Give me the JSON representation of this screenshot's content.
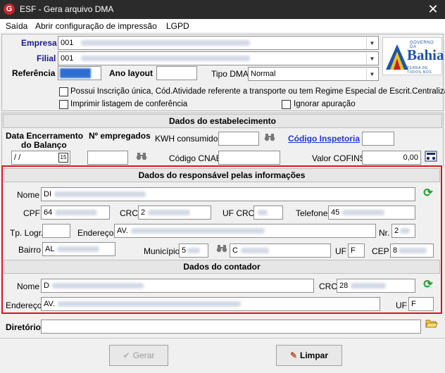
{
  "window": {
    "title": "ESF - Gera arquivo DMA",
    "app_icon_letter": "G"
  },
  "menu": [
    "Saída",
    "Abrir configuração de impressão",
    "LGPD"
  ],
  "header": {
    "empresa_label": "Empresa",
    "empresa_value": "001",
    "filial_label": "Filial",
    "filial_value": "001",
    "referencia_label": "Referência",
    "ano_layout_label": "Ano layout",
    "ano_layout_value": "",
    "tipo_dma_label": "Tipo DMA",
    "tipo_dma_value": "Normal",
    "logo_small": "GOVERNO DA",
    "logo_big": "Bahia",
    "logo_sub": "TERRA DE TODOS NÓS"
  },
  "options": {
    "inscricao_unica": "Possui Inscrição única, Cód.Atividade referente a transporte ou tem Regime Especial de Escrit.Centralizada",
    "imprimir_listagem": "Imprimir listagem de conferência",
    "ignorar_apuracao": "Ignorar apuração"
  },
  "estabelecimento": {
    "title": "Dados do estabelecimento",
    "data_enc_label_1": "Data Encerramento",
    "data_enc_label_2": "do Balanço",
    "data_enc_value": "/ /",
    "empregados_label": "Nº empregados",
    "kwh_label": "KWH consumidos",
    "codigo_inspetoria_label": "Código Inspetoria",
    "codigo_cnae_label": "Código CNAE",
    "valor_cofins_label": "Valor COFINS",
    "valor_cofins_value": "0,00"
  },
  "responsavel": {
    "title": "Dados do responsável pelas informações",
    "nome_label": "Nome",
    "nome_value": "DI",
    "cpf_label": "CPF",
    "cpf_value": "64",
    "crc_label": "CRC",
    "crc_value": "2",
    "uf_crc_label": "UF CRC",
    "uf_crc_value": "",
    "telefone_label": "Telefone",
    "telefone_value": "45",
    "tp_logr_label": "Tp. Logr.",
    "endereco_label": "Endereço",
    "endereco_value": "AV.",
    "nr_label": "Nr.",
    "nr_value": "2",
    "bairro_label": "Bairro",
    "bairro_value": "AL",
    "municipio_label": "Município",
    "municipio_value": "5",
    "municipio_name_value": "C",
    "uf_label": "UF",
    "uf_value": "F",
    "cep_label": "CEP",
    "cep_value": "8"
  },
  "contador": {
    "title": "Dados do contador",
    "nome_label": "Nome",
    "nome_value": "D",
    "crc_label": "CRC",
    "crc_value": "28",
    "endereco_label": "Endereço",
    "endereco_value": "AV.",
    "uf_label": "UF",
    "uf_value": "F"
  },
  "diretorio": {
    "label": "Diretório",
    "value": ""
  },
  "buttons": {
    "gerar": "Gerar",
    "limpar": "Limpar"
  },
  "colors": {
    "highlight_border": "#d8161b",
    "title_bar": "#2b2b2b",
    "label_blue": "#1a1a8c",
    "link_blue": "#1a3ad0"
  }
}
